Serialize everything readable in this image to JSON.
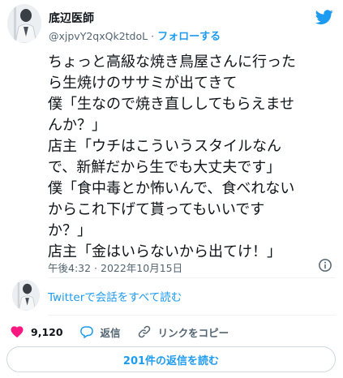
{
  "author": {
    "display_name": "底辺医師",
    "handle": "@xjpvY2qxQk2tdoL",
    "separator": "·",
    "follow_label": "フォローする",
    "avatar_icon": "avatar-photo"
  },
  "tweet": {
    "lines": [
      "ちょっと高級な焼き鳥屋さんに行った",
      "ら生焼けのササミが出てきて",
      "僕「生なので焼き直ししてもらえませ",
      "んか？」",
      "店主「ウチはこういうスタイルなん",
      "で、新鮮だから生でも大丈夫です」",
      "僕「食中毒とか怖いんで、食べれない",
      "からこれ下げて貰ってもいいです",
      "か？」",
      "店主「金はいらないから出てけ！」"
    ],
    "timestamp": "午後4:32 · 2022年10月15日"
  },
  "conversation": {
    "link_label": "Twitterで会話をすべて読む"
  },
  "actions": {
    "like_count": "9,120",
    "reply_label": "返信",
    "copy_link_label": "リンクをコピー"
  },
  "replies_button": {
    "label": "201件の返信を読む"
  },
  "colors": {
    "accent": "#1d9bf0",
    "like_red": "#f91880",
    "secondary_text": "#536471",
    "primary_text": "#0f1419",
    "border": "#cfd9de"
  },
  "icons": [
    "twitter-bird-icon",
    "info-icon",
    "heart-icon",
    "reply-icon",
    "link-icon"
  ]
}
